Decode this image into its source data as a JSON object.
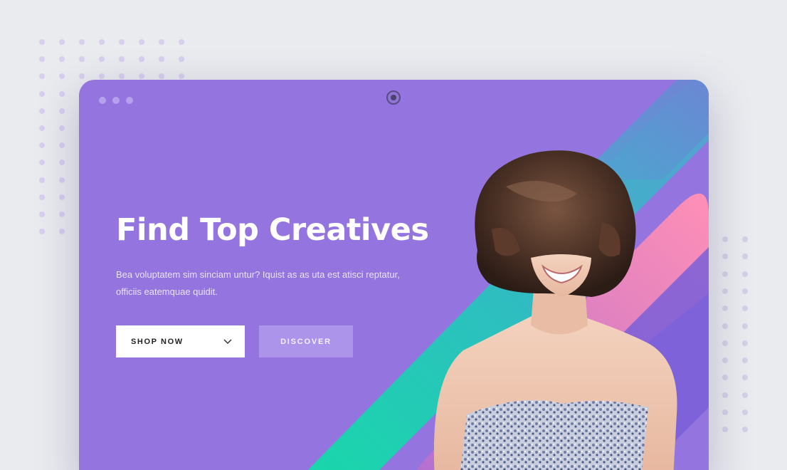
{
  "hero": {
    "title": "Find Top Creatives",
    "description": "Bea voluptatem sim sinciam untur? Iquist as as uta est atisci reptatur, officiis eatemquae quidit."
  },
  "actions": {
    "shop_now_label": "SHOP NOW",
    "discover_label": "DISCOVER"
  },
  "icons": {
    "shop_now_dropdown": "chevron-down-icon"
  },
  "colors": {
    "background": "#e9ebef",
    "window": "#9474de",
    "accent_teal": "#1fd3b0",
    "accent_pink": "#f590c0",
    "accent_blue": "#6d8fd8"
  }
}
